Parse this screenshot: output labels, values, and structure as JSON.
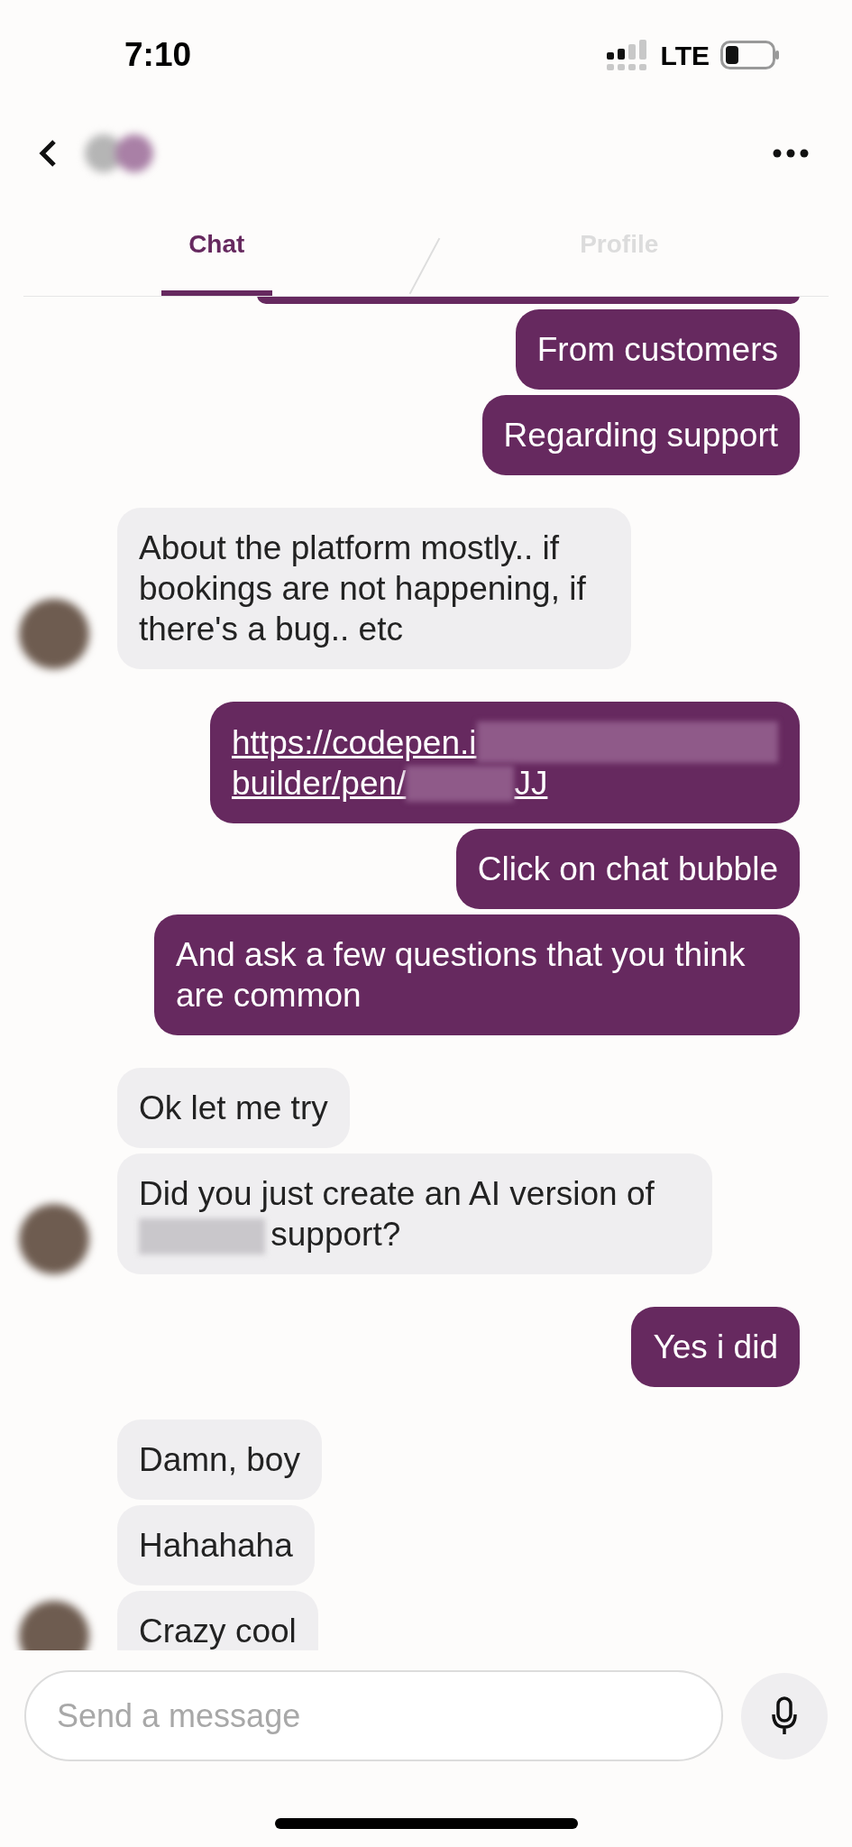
{
  "status_bar": {
    "time": "7:10",
    "network": "LTE"
  },
  "tabs": [
    {
      "label": "Chat",
      "selected": true
    },
    {
      "label": "Profile",
      "selected": false
    }
  ],
  "groups": [
    {
      "outgoing": true,
      "messages": [
        {
          "kind": "partial"
        },
        {
          "kind": "text",
          "text": "From customers"
        },
        {
          "kind": "text",
          "text": "Regarding support"
        }
      ]
    },
    {
      "outgoing": false,
      "messages": [
        {
          "kind": "text",
          "text": "About the platform mostly.. if bookings are not happening, if there's a bug.. etc"
        }
      ]
    },
    {
      "outgoing": true,
      "messages": [
        {
          "kind": "link",
          "lines": [
            [
              {
                "kind": "text",
                "text": "https://codepen.i"
              },
              {
                "kind": "redacted"
              }
            ],
            [
              {
                "kind": "text",
                "text": "builder/pen/"
              },
              {
                "kind": "redacted"
              },
              {
                "kind": "text",
                "text": "JJ"
              }
            ]
          ]
        },
        {
          "kind": "text",
          "text": "Click on chat bubble"
        },
        {
          "kind": "text",
          "text": "And ask a few questions that you think are common"
        }
      ]
    },
    {
      "outgoing": false,
      "messages": [
        {
          "kind": "text",
          "text": "Ok let me try"
        },
        {
          "kind": "segments",
          "segments": [
            {
              "kind": "text",
              "text": "Did you just create an AI version of"
            },
            {
              "kind": "redacted"
            },
            {
              "kind": "text",
              "text": "support?"
            }
          ]
        }
      ]
    },
    {
      "outgoing": true,
      "messages": [
        {
          "kind": "text",
          "text": "Yes i did"
        }
      ]
    },
    {
      "outgoing": false,
      "messages": [
        {
          "kind": "text",
          "text": "Damn, boy"
        },
        {
          "kind": "text",
          "text": "Hahahaha"
        },
        {
          "kind": "text",
          "text": "Crazy cool"
        }
      ]
    }
  ],
  "composer": {
    "placeholder": "Send a message"
  }
}
